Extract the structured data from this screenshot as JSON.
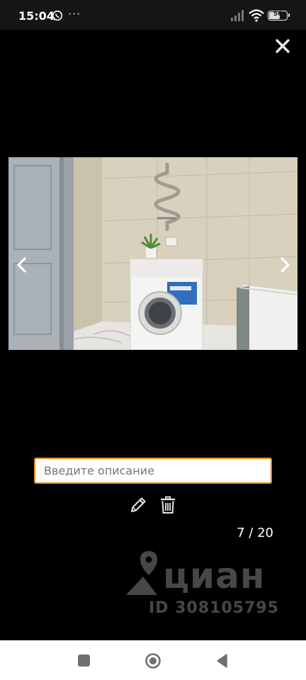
{
  "status_bar": {
    "time": "15:04",
    "more": "···",
    "battery": "56",
    "battery_level": 0.56
  },
  "viewer": {
    "description_placeholder": "Введите описание",
    "counter": "7 / 20",
    "current_photo": 7,
    "total_photos": 20
  },
  "watermark": {
    "brand": "циан",
    "id_text": "ID 308105795"
  },
  "icons": {
    "close": "close-icon",
    "prev": "chevron-left-icon",
    "next": "chevron-right-icon",
    "edit": "pencil-icon",
    "delete": "trash-icon"
  },
  "colors": {
    "accent_border": "#e88a1e",
    "background": "#000000",
    "nav_bar": "#ffffff"
  }
}
